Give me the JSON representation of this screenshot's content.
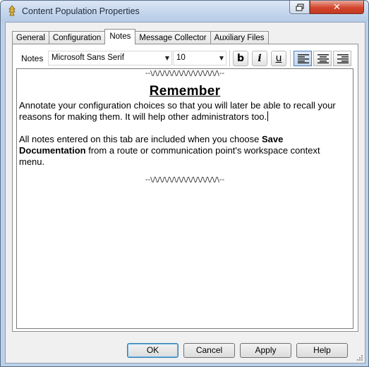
{
  "window": {
    "title": "Content Population Properties"
  },
  "tabs": [
    {
      "label": "General"
    },
    {
      "label": "Configuration"
    },
    {
      "label": "Notes"
    },
    {
      "label": "Message Collector"
    },
    {
      "label": "Auxiliary Files"
    }
  ],
  "toolbar": {
    "label": "Notes",
    "font_name": "Microsoft Sans Serif",
    "font_size": "10",
    "bold": "b",
    "italic": "i",
    "underline": "u",
    "alignment_selected": "left"
  },
  "editor": {
    "wave": "--\\/\\/\\/\\/\\/\\/\\/\\/\\/\\/\\/\\/\\/\\/\\--",
    "heading": "Remember",
    "para1": "Annotate your configuration choices so that you will later be able to recall your reasons for making them. It will help other administrators too.",
    "para2_a": "All notes entered on this tab are included when you choose ",
    "para2_bold": "Save Documentation",
    "para2_b": " from a route or communication point's workspace context menu."
  },
  "buttons": {
    "ok": "OK",
    "cancel": "Cancel",
    "apply": "Apply",
    "help": "Help"
  }
}
